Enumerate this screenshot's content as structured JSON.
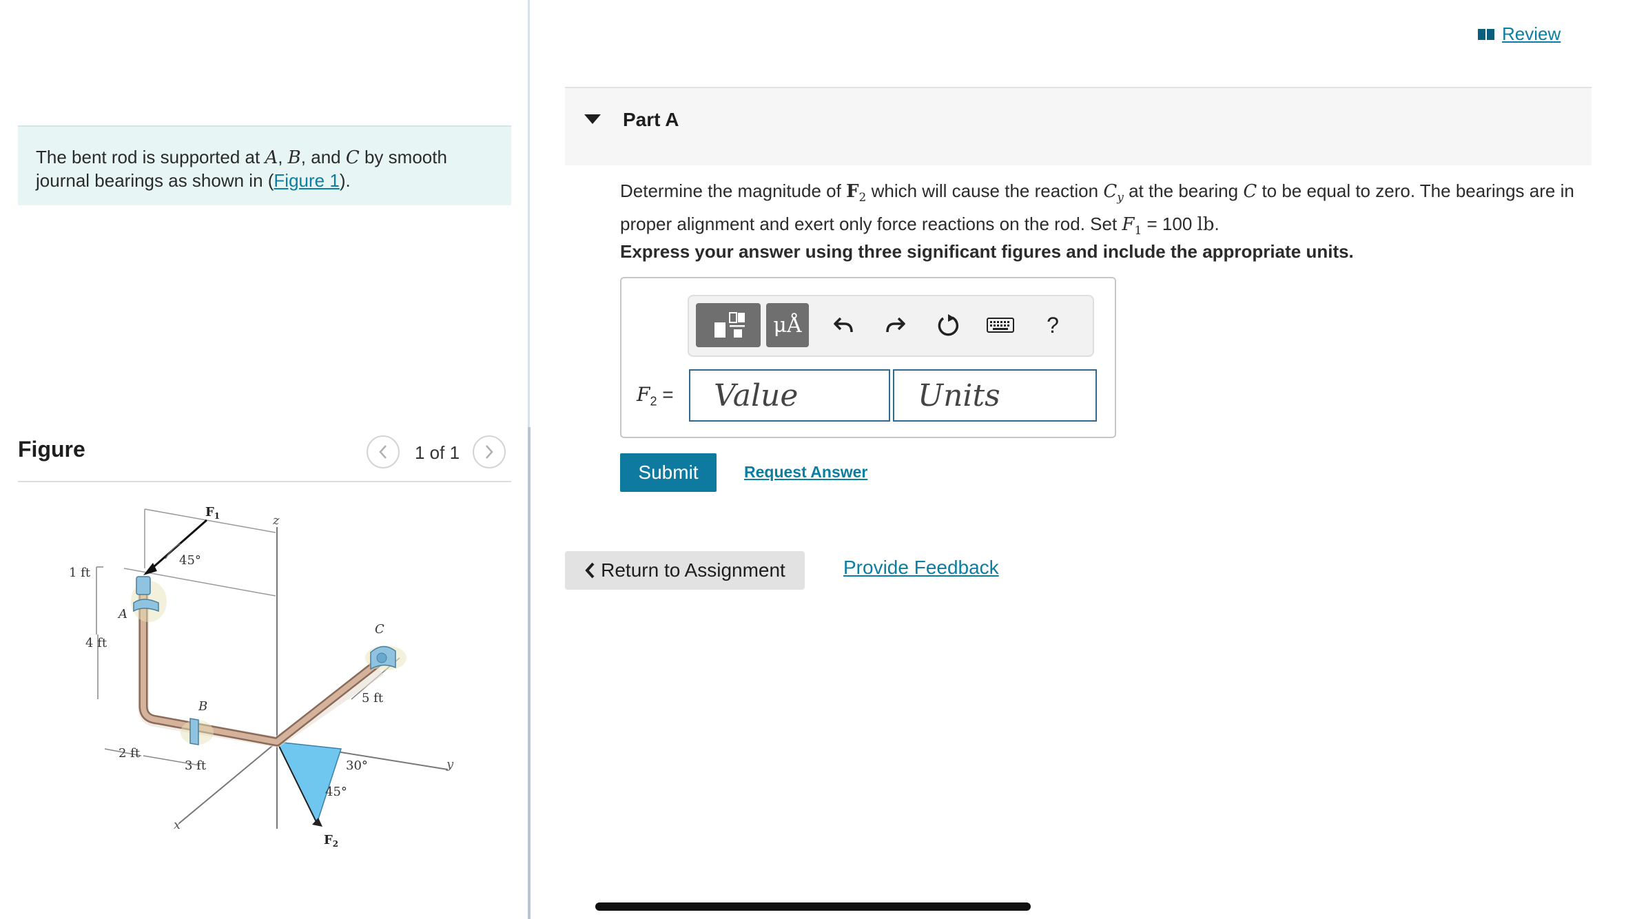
{
  "problem": {
    "text_1": "The bent rod is supported at ",
    "point_a": "A",
    "sep_1": ", ",
    "point_b": "B",
    "sep_2": ", and ",
    "point_c": "C",
    "text_2": " by smooth journal bearings as shown in (",
    "figure_link": "Figure 1",
    "text_3": ")."
  },
  "figure": {
    "title": "Figure",
    "counter": "1 of 1",
    "labels": {
      "f1": "F",
      "f1_sub": "1",
      "f2": "F",
      "f2_sub": "2",
      "angle_45_top": "45°",
      "dim_1ft": "1 ft",
      "dim_4ft": "4 ft",
      "dim_2ft": "2 ft",
      "dim_3ft": "3 ft",
      "dim_5ft": "5 ft",
      "angle_30": "30°",
      "angle_45_bottom": "45°",
      "pt_a": "A",
      "pt_b": "B",
      "pt_c": "C",
      "axis_x": "x",
      "axis_y": "y",
      "axis_z": "z"
    }
  },
  "header": {
    "review_label": "Review"
  },
  "part": {
    "title": "Part A"
  },
  "question": {
    "t1": "Determine the magnitude of ",
    "f2": "F",
    "f2_sub": "2",
    "t2": " which will cause the reaction ",
    "cy": "C",
    "cy_sub": "y",
    "t3": " at the bearing ",
    "c": "C",
    "t4": " to be equal to zero. The bearings are in proper alignment and exert only force reactions on the rod. Set ",
    "f1": "F",
    "f1_sub": "1",
    "t5": " = 100 ",
    "unit": "lb",
    "t6": "."
  },
  "instruction": "Express your answer using three significant figures and include the appropriate units.",
  "answer": {
    "label": "F",
    "label_sub": "2",
    "label_eq": " =",
    "value_placeholder": "Value",
    "units_placeholder": "Units",
    "toolbar": {
      "units_symbol": "μÅ",
      "help": "?"
    }
  },
  "actions": {
    "submit": "Submit",
    "request_answer": "Request Answer",
    "return": "Return to Assignment",
    "feedback": "Provide Feedback"
  },
  "colors": {
    "link": "#0b7ea1",
    "submit_bg": "#0e7aa0",
    "problem_bg": "#e8f5f5",
    "rod": "#c9a48a",
    "bearing": "#8fc3e0"
  }
}
